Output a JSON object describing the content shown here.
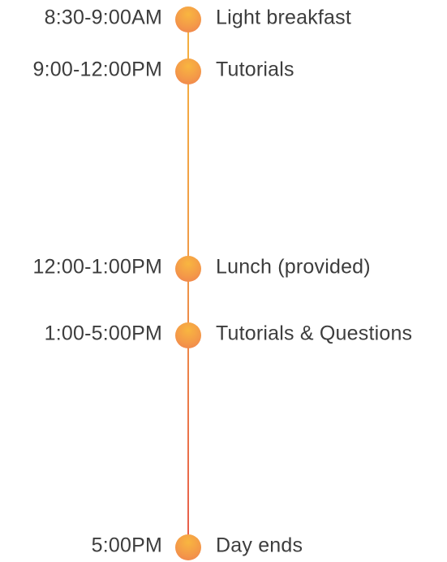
{
  "schedule": {
    "items": [
      {
        "time": "8:30-9:00AM",
        "label": "Light breakfast"
      },
      {
        "time": "9:00-12:00PM",
        "label": "Tutorials"
      },
      {
        "time": "12:00-1:00PM",
        "label": "Lunch (provided)"
      },
      {
        "time": "1:00-5:00PM",
        "label": "Tutorials & Questions"
      },
      {
        "time": "5:00PM",
        "label": "Day ends"
      }
    ]
  },
  "colors": {
    "line_top": "#f5b13f",
    "line_bottom": "#e85b4a",
    "dot": "#f49a48",
    "text": "#3d3d3d"
  }
}
